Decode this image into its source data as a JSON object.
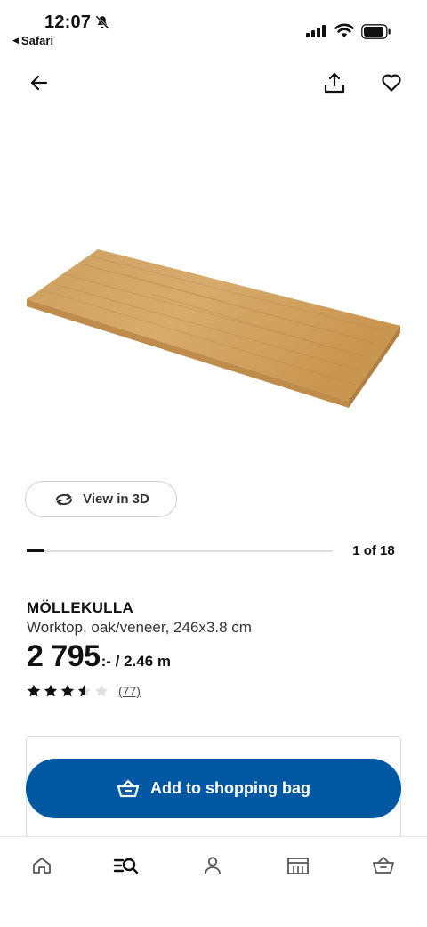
{
  "status_bar": {
    "time": "12:07",
    "back_app_label": "Safari"
  },
  "header": {
    "back_icon": "arrow-left-icon",
    "share_icon": "share-icon",
    "favorite_icon": "heart-icon"
  },
  "gallery": {
    "view3d_label": "View in 3D",
    "counter": "1 of 18",
    "progress_fraction": 0.0556
  },
  "product": {
    "name": "MÖLLEKULLA",
    "description": "Worktop, oak/veneer, 246x3.8 cm",
    "price_main": "2 795",
    "price_suffix": ":- / 2.46 m",
    "rating": 3.5,
    "rating_max": 5,
    "review_count": "(77)"
  },
  "actions": {
    "add_to_bag_label": "Add to shopping bag"
  },
  "bottom_nav": {
    "tabs": [
      "home-icon",
      "search-list-icon",
      "profile-icon",
      "store-icon",
      "shopping-bag-icon"
    ]
  },
  "colors": {
    "primary": "#0058a3",
    "text": "#111111",
    "star_empty": "#dfdfdf"
  }
}
